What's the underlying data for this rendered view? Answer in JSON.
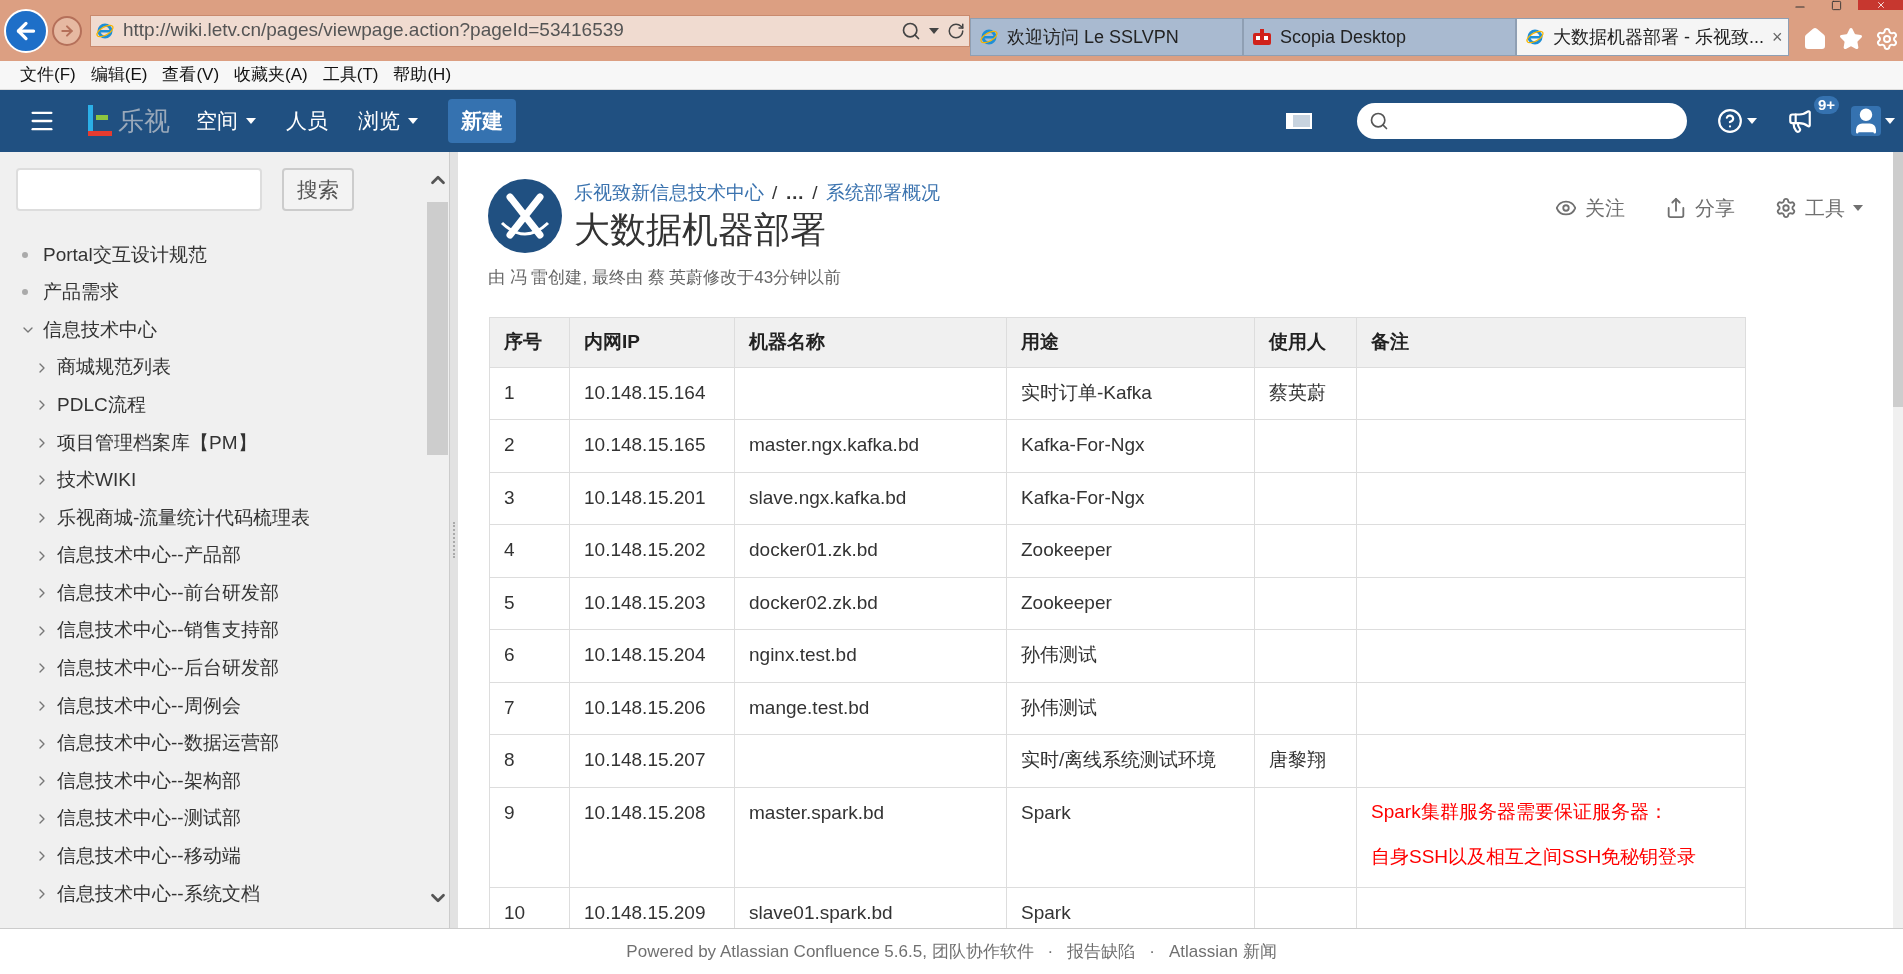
{
  "browser": {
    "address": "http://wiki.letv.cn/pages/viewpage.action?pageId=53416539",
    "tabs": [
      {
        "title": "欢迎访问 Le SSLVPN",
        "kind": "ie",
        "selected": false
      },
      {
        "title": "Scopia Desktop",
        "kind": "scopia",
        "selected": false
      },
      {
        "title": "大数据机器部署 - 乐视致...",
        "kind": "ie",
        "selected": true,
        "close": "×"
      }
    ],
    "menu": [
      "文件(F)",
      "编辑(E)",
      "查看(V)",
      "收藏夹(A)",
      "工具(T)",
      "帮助(H)"
    ]
  },
  "header": {
    "logo": "乐视",
    "nav": [
      {
        "label": "空间",
        "has_menu": true
      },
      {
        "label": "人员",
        "has_menu": false
      },
      {
        "label": "浏览",
        "has_menu": true
      }
    ],
    "create_button": "新建",
    "notification_badge": "9+"
  },
  "sidebar": {
    "search_button": "搜索",
    "items": [
      {
        "label": "Portal交互设计规范",
        "kind": "bullet"
      },
      {
        "label": "产品需求",
        "kind": "bullet"
      },
      {
        "label": "信息技术中心",
        "kind": "folder",
        "expanded": true,
        "children": [
          {
            "label": "商城规范列表",
            "kind": "folder",
            "expanded": false
          },
          {
            "label": "PDLC流程",
            "kind": "folder",
            "expanded": false
          },
          {
            "label": "项目管理档案库【PM】",
            "kind": "folder",
            "expanded": false
          },
          {
            "label": "技术WIKI",
            "kind": "folder",
            "expanded": false
          },
          {
            "label": "乐视商城-流量统计代码梳理表",
            "kind": "folder",
            "expanded": false
          },
          {
            "label": "信息技术中心--产品部",
            "kind": "folder",
            "expanded": false
          },
          {
            "label": "信息技术中心--前台研发部",
            "kind": "folder",
            "expanded": false
          },
          {
            "label": "信息技术中心--销售支持部",
            "kind": "folder",
            "expanded": false
          },
          {
            "label": "信息技术中心--后台研发部",
            "kind": "folder",
            "expanded": false
          },
          {
            "label": "信息技术中心--周例会",
            "kind": "folder",
            "expanded": false
          },
          {
            "label": "信息技术中心--数据运营部",
            "kind": "folder",
            "expanded": false
          },
          {
            "label": "信息技术中心--架构部",
            "kind": "folder",
            "expanded": false
          },
          {
            "label": "信息技术中心--测试部",
            "kind": "folder",
            "expanded": false
          },
          {
            "label": "信息技术中心--移动端",
            "kind": "folder",
            "expanded": false
          },
          {
            "label": "信息技术中心--系统文档",
            "kind": "folder",
            "expanded": false
          }
        ]
      }
    ]
  },
  "page": {
    "breadcrumbs": [
      {
        "label": "乐视致新信息技术中心",
        "kind": "link"
      },
      {
        "label": "…",
        "kind": "ellipsis"
      },
      {
        "label": "系统部署概况",
        "kind": "link"
      }
    ],
    "breadcrumb_separator": "/",
    "title": "大数据机器部署",
    "byline": "由 冯 雷创建, 最终由 蔡 英蔚修改于43分钟以前",
    "actions": [
      {
        "label": "关注",
        "kind": "watch"
      },
      {
        "label": "分享",
        "kind": "share"
      },
      {
        "label": "工具",
        "kind": "tools"
      }
    ]
  },
  "table": {
    "columns": [
      "序号",
      "内网IP",
      "机器名称",
      "用途",
      "使用人",
      "备注"
    ],
    "rows": [
      {
        "no": "1",
        "ip": "10.148.15.164",
        "use": "实时订单-Kafka",
        "user": "蔡英蔚"
      },
      {
        "no": "2",
        "ip": "10.148.15.165",
        "host": "master.ngx.kafka.bd",
        "use": "Kafka-For-Ngx"
      },
      {
        "no": "3",
        "ip": "10.148.15.201",
        "host": "slave.ngx.kafka.bd",
        "use": "Kafka-For-Ngx"
      },
      {
        "no": "4",
        "ip": "10.148.15.202",
        "host": "docker01.zk.bd",
        "use": "Zookeeper"
      },
      {
        "no": "5",
        "ip": "10.148.15.203",
        "host": "docker02.zk.bd",
        "use": "Zookeeper"
      },
      {
        "no": "6",
        "ip": "10.148.15.204",
        "host": "nginx.test.bd",
        "use": "孙伟测试"
      },
      {
        "no": "7",
        "ip": "10.148.15.206",
        "host": "mange.test.bd",
        "use": "孙伟测试"
      },
      {
        "no": "8",
        "ip": "10.148.15.207",
        "use": "实时/离线系统测试环境",
        "user": "唐黎翔"
      },
      {
        "no": "9",
        "ip": "10.148.15.208",
        "host": "master.spark.bd",
        "use": "Spark",
        "note": {
          "lines": [
            "Spark集群服务器需要保证服务器：",
            "自身SSH以及相互之间SSH免秘钥登录"
          ],
          "color": "#ff0000"
        }
      },
      {
        "no": "10",
        "ip": "10.148.15.209",
        "host": "slave01.spark.bd",
        "use": "Spark"
      }
    ]
  },
  "footer": {
    "items": [
      "Powered by Atlassian Confluence 5.6.5, 团队协作软件",
      "报告缺陷",
      "Atlassian 新闻"
    ],
    "separator": "·"
  }
}
